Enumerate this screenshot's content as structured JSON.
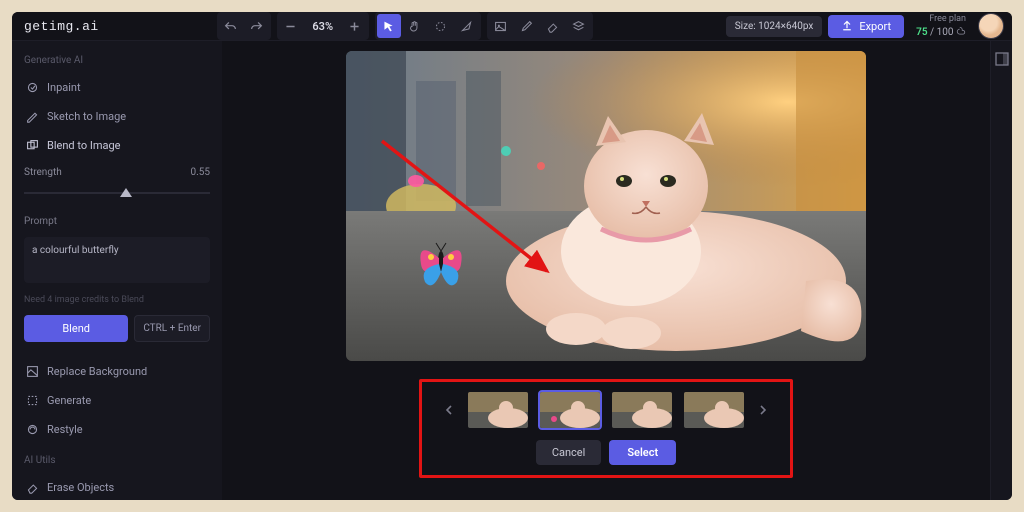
{
  "brand": "getimg.ai",
  "toolbar": {
    "zoom_pct": "63%",
    "size_label": "Size: 1024×640px",
    "export_label": "Export"
  },
  "account": {
    "plan_label": "Free plan",
    "credits_current": "75",
    "credits_sep": " / ",
    "credits_total": "100"
  },
  "sidebar": {
    "section_gen": "Generative AI",
    "items_gen": [
      {
        "label": "Inpaint"
      },
      {
        "label": "Sketch to Image"
      },
      {
        "label": "Blend to Image"
      }
    ],
    "strength_label": "Strength",
    "strength_value": "0.55",
    "prompt_label": "Prompt",
    "prompt_value": "a colourful butterfly",
    "hint": "Need 4 image credits to Blend",
    "blend_label": "Blend",
    "kbd_label": "CTRL + Enter",
    "items_bg": [
      {
        "label": "Replace Background"
      },
      {
        "label": "Generate"
      },
      {
        "label": "Restyle"
      }
    ],
    "section_utils": "AI Utils",
    "items_utils": [
      {
        "label": "Erase Objects"
      }
    ]
  },
  "resultbar": {
    "cancel": "Cancel",
    "select": "Select"
  }
}
